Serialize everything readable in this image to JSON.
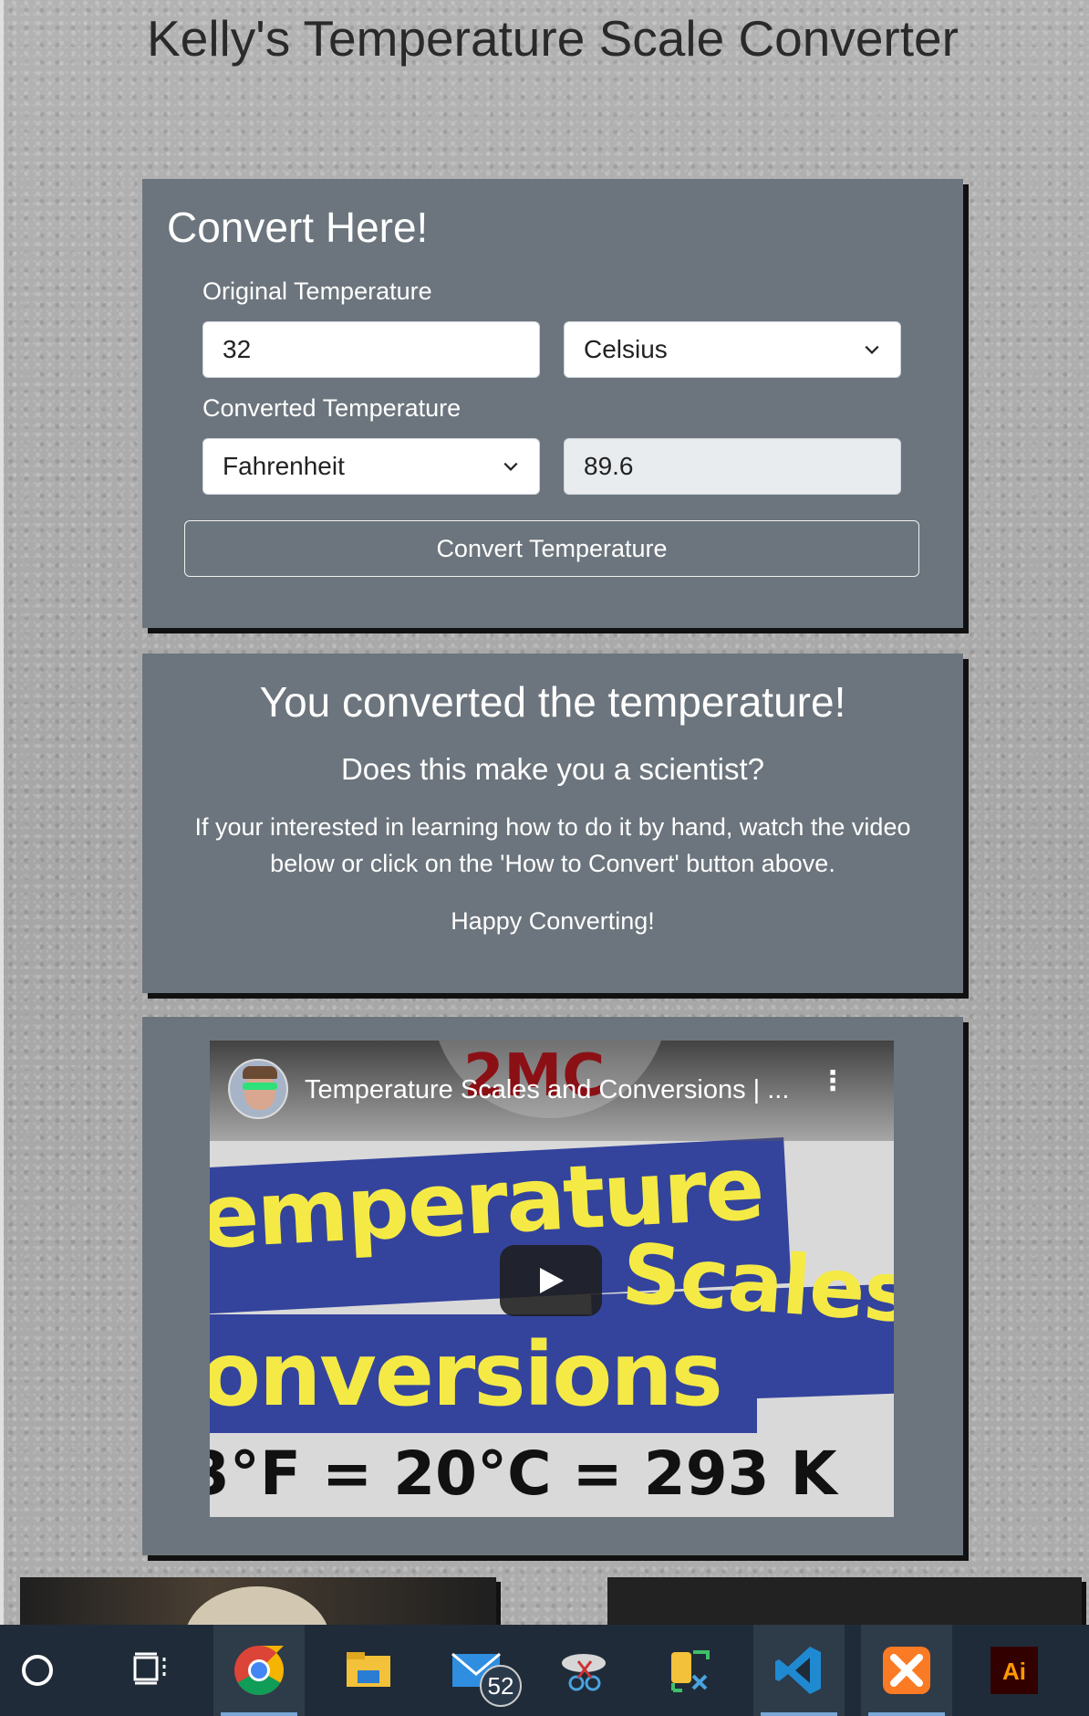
{
  "page": {
    "title": "Kelly's Temperature Scale Converter"
  },
  "converter": {
    "heading": "Convert Here!",
    "original_label": "Original Temperature",
    "original_value": "32",
    "original_unit": "Celsius",
    "converted_label": "Converted Temperature",
    "converted_unit": "Fahrenheit",
    "converted_value": "89.6",
    "button_label": "Convert Temperature"
  },
  "message": {
    "heading": "You converted the temperature!",
    "subheading": "Does this make you a scientist?",
    "body": "If your interested in learning how to do it by hand, watch the video below or click on the 'How to Convert' button above.",
    "closing": "Happy Converting!"
  },
  "video": {
    "channel_brand": "2MC",
    "title": "Temperature Scales and Conversions | ...",
    "thumb_line1": "emperature",
    "thumb_line2": "Scales",
    "thumb_line3": "onversions",
    "thumb_line4": "3°F = 20°C = 293 K"
  },
  "taskbar": {
    "items": [
      "cortana",
      "task-view",
      "chrome",
      "file-explorer",
      "mail",
      "snipping-tool",
      "toolbox",
      "vscode",
      "xampp",
      "illustrator"
    ],
    "mail_badge": "52",
    "illustrator_label": "Ai"
  },
  "colors": {
    "card": "#6c757d",
    "taskbar": "#1f2b38",
    "thumb_yellow": "#f5ea45",
    "thumb_blue": "#34449c"
  }
}
